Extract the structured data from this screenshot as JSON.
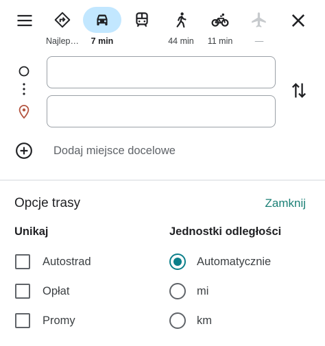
{
  "modes": [
    {
      "id": "best",
      "icon": "best-route-icon",
      "label": "Najlep…",
      "active": false
    },
    {
      "id": "car",
      "icon": "car-icon",
      "label": "7 min",
      "active": true
    },
    {
      "id": "transit",
      "icon": "train-icon",
      "label": "",
      "active": false
    },
    {
      "id": "walk",
      "icon": "walking-icon",
      "label": "44 min",
      "active": false
    },
    {
      "id": "bike",
      "icon": "bicycle-icon",
      "label": "11 min",
      "active": false
    },
    {
      "id": "flight",
      "icon": "airplane-icon",
      "label": "—",
      "active": false,
      "disabled": true
    }
  ],
  "inputs": {
    "start_value": "",
    "destination_value": ""
  },
  "add_destination": "Dodaj miejsce docelowe",
  "route_options": {
    "title": "Opcje trasy",
    "close_label": "Zamknij",
    "avoid": {
      "heading": "Unikaj",
      "items": [
        {
          "label": "Autostrad",
          "checked": false
        },
        {
          "label": "Opłat",
          "checked": false
        },
        {
          "label": "Promy",
          "checked": false
        }
      ]
    },
    "units": {
      "heading": "Jednostki odległości",
      "items": [
        {
          "label": "Automatycznie",
          "selected": true
        },
        {
          "label": "mi",
          "selected": false
        },
        {
          "label": "km",
          "selected": false
        }
      ]
    }
  },
  "colors": {
    "active_mode_bg": "#c2e7ff",
    "accent": "#0b7f8a",
    "destination_pin": "#b3533e"
  }
}
